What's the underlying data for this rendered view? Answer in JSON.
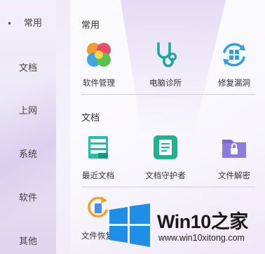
{
  "sidebar": {
    "items": [
      {
        "label": "常用",
        "active": true
      },
      {
        "label": "文档"
      },
      {
        "label": "上网"
      },
      {
        "label": "系统"
      },
      {
        "label": "软件"
      },
      {
        "label": "其他"
      }
    ]
  },
  "sections": {
    "common": {
      "title": "常用",
      "tools": [
        "软件管理",
        "电脑诊所",
        "修复漏洞"
      ]
    },
    "docs": {
      "title": "文档",
      "tools": [
        "最近文档",
        "文档守护者",
        "文件解密"
      ]
    },
    "more": {
      "tools": [
        "文件恢复"
      ]
    }
  },
  "watermark": {
    "title": "Win10之家",
    "url": "www.win10xitong.com",
    "colors": {
      "logo": "#1e8fe6"
    }
  },
  "icons": {
    "software": "clover-icon",
    "clinic": "stethoscope-icon",
    "repair": "windows-refresh-icon",
    "recent": "stacked-docs-icon",
    "guard": "document-shield-icon",
    "decrypt": "locked-folder-icon",
    "recover": "recover-icon"
  }
}
